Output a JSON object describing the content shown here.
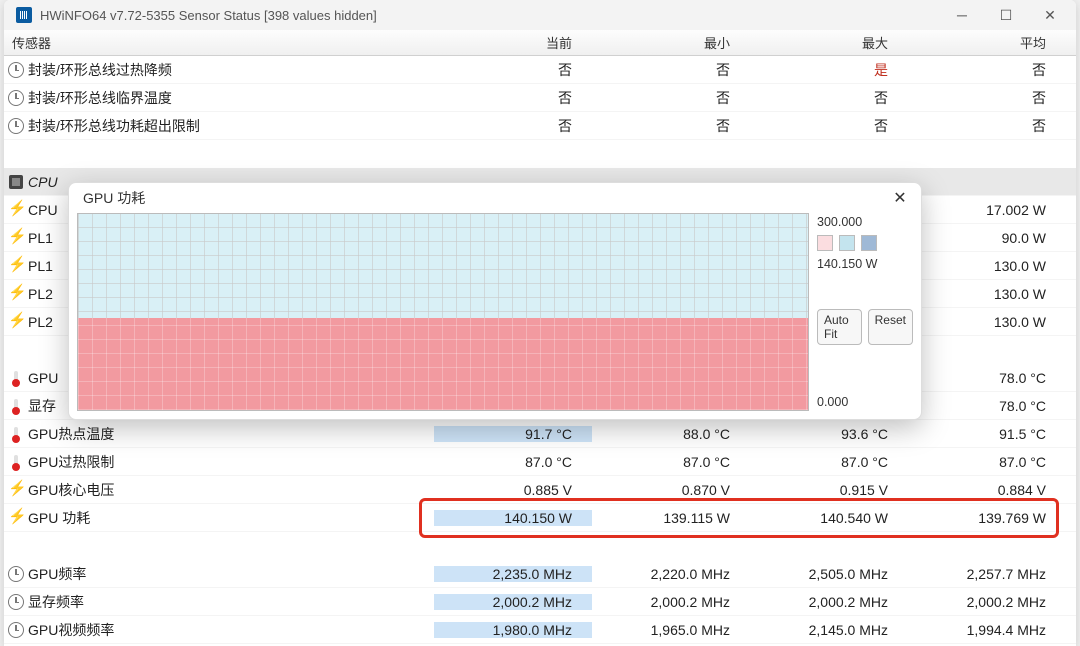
{
  "window": {
    "title": "HWiNFO64 v7.72-5355 Sensor Status [398 values hidden]"
  },
  "headers": {
    "sensor": "传感器",
    "current": "当前",
    "min": "最小",
    "max": "最大",
    "avg": "平均"
  },
  "rows": [
    {
      "icon": "clock",
      "name": "封装/环形总线过热降频",
      "vals": [
        "否",
        "否",
        "是",
        "否"
      ],
      "max_red": true
    },
    {
      "icon": "clock",
      "name": "封装/环形总线临界温度",
      "vals": [
        "否",
        "否",
        "否",
        "否"
      ]
    },
    {
      "icon": "clock",
      "name": "封装/环形总线功耗超出限制",
      "vals": [
        "否",
        "否",
        "否",
        "否"
      ]
    },
    {
      "type": "spacer"
    },
    {
      "icon": "chip",
      "group": true,
      "name": "CPU",
      "vals": [
        "",
        "",
        "",
        ""
      ]
    },
    {
      "icon": "bolt",
      "name": "CPU",
      "vals": [
        "",
        "",
        "",
        "17.002 W"
      ]
    },
    {
      "icon": "bolt",
      "name": "PL1",
      "vals": [
        "",
        "",
        "",
        "90.0 W"
      ]
    },
    {
      "icon": "bolt",
      "name": "PL1",
      "vals": [
        "",
        "",
        "",
        "130.0 W"
      ]
    },
    {
      "icon": "bolt",
      "name": "PL2",
      "vals": [
        "",
        "",
        "",
        "130.0 W"
      ]
    },
    {
      "icon": "bolt",
      "name": "PL2",
      "vals": [
        "",
        "",
        "",
        "130.0 W"
      ]
    },
    {
      "type": "spacer"
    },
    {
      "icon": "therm",
      "name": "GPU",
      "vals": [
        "",
        "",
        "",
        "78.0 °C"
      ]
    },
    {
      "icon": "therm",
      "name": "显存",
      "vals": [
        "",
        "",
        "",
        "78.0 °C"
      ]
    },
    {
      "icon": "therm",
      "name": "GPU热点温度",
      "vals": [
        "91.7 °C",
        "88.0 °C",
        "93.6 °C",
        "91.5 °C"
      ],
      "cur_sel": true
    },
    {
      "icon": "therm",
      "name": "GPU过热限制",
      "vals": [
        "87.0 °C",
        "87.0 °C",
        "87.0 °C",
        "87.0 °C"
      ]
    },
    {
      "icon": "bolt",
      "name": "GPU核心电压",
      "vals": [
        "0.885 V",
        "0.870 V",
        "0.915 V",
        "0.884 V"
      ]
    },
    {
      "icon": "bolt",
      "name": "GPU 功耗",
      "vals": [
        "140.150 W",
        "139.115 W",
        "140.540 W",
        "139.769 W"
      ],
      "cur_sel": true,
      "highlight": true
    },
    {
      "type": "spacer"
    },
    {
      "icon": "clock",
      "name": "GPU频率",
      "vals": [
        "2,235.0 MHz",
        "2,220.0 MHz",
        "2,505.0 MHz",
        "2,257.7 MHz"
      ],
      "cur_sel": true
    },
    {
      "icon": "clock",
      "name": "显存频率",
      "vals": [
        "2,000.2 MHz",
        "2,000.2 MHz",
        "2,000.2 MHz",
        "2,000.2 MHz"
      ],
      "cur_sel": true
    },
    {
      "icon": "clock",
      "name": "GPU视频频率",
      "vals": [
        "1,980.0 MHz",
        "1,965.0 MHz",
        "2,145.0 MHz",
        "1,994.4 MHz"
      ],
      "cur_sel": true
    }
  ],
  "popup": {
    "title": "GPU 功耗",
    "y_max": "300.000",
    "y_current": "140.150 W",
    "y_min": "0.000",
    "btn_autofit": "Auto Fit",
    "btn_reset": "Reset"
  },
  "chart_data": {
    "type": "area",
    "title": "GPU 功耗",
    "ylabel": "W",
    "ylim": [
      0,
      300
    ],
    "series": [
      {
        "name": "GPU 功耗",
        "values_approx_constant": 140.15
      }
    ],
    "note": "value holds roughly flat near 140 W across the visible window"
  }
}
